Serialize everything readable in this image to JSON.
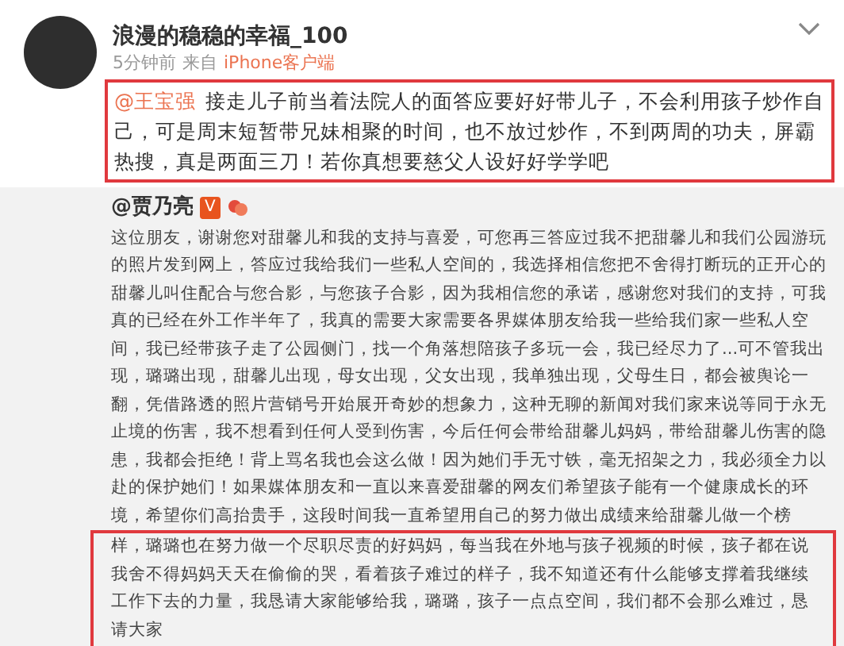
{
  "post": {
    "author": "浪漫的稳稳的幸福_100",
    "time": "5分钟前",
    "source_prefix": "来自",
    "source": "iPhone客户端",
    "mention": "@王宝强",
    "text": "接走儿子前当着法院人的面答应要好好带儿子，不会利用孩子炒作自己，可是周末短暂带兄妹相聚的时间，也不放过炒作，不到两周的功夫，屏霸热搜，真是两面三刀！若你真想要慈父人设好好学学吧"
  },
  "repost": {
    "author": "@贾乃亮",
    "verified_badge": "V",
    "text": "这位朋友，谢谢您对甜馨儿和我的支持与喜爱，可您再三答应过我不把甜馨儿和我们公园游玩的照片发到网上，答应过我给我们一些私人空间的，我选择相信您把不舍得打断玩的正开心的甜馨儿叫住配合与您合影，与您孩子合影，因为我相信您的承诺，感谢您对我们的支持，可我真的已经在外工作半年了，我真的需要大家需要各界媒体朋友给我一些给我们家一些私人空间，我已经带孩子走了公园侧门，找一个角落想陪孩子多玩一会，我已经尽力了...可不管我出现，璐璐出现，甜馨儿出现，母女出现，父女出现，我单独出现，父母生日，都会被舆论一翻，凭借路透的照片营销号开始展开奇妙的想象力，这种无聊的新闻对我们家来说等同于永无止境的伤害，我不想看到任何人受到伤害，今后任何会带给甜馨儿妈妈，带给甜馨儿伤害的隐患，我都会拒绝！背上骂名我也会这么做！因为她们手无寸铁，毫无招架之力，我必须全力以赴的保护她们！如果媒体朋友和一直以来喜爱甜馨的网友们希望孩子能有一个健康成长的环境，希望你们高抬贵手，这段时间我一直希望用自己的努力做出成绩来给甜馨儿做一个榜",
    "highlighted_text": "样，璐璐也在努力做一个尽职尽责的好妈妈，每当我在外地与孩子视频的时候，孩子都在说我舍不得妈妈天天在偷偷的哭，看着孩子难过的样子，我不知道还有什么能够支撑着我继续工作下去的力量，我恳请大家能够给我，璐璐，孩子一点点空间，我们都不会那么难过，恳请大家"
  }
}
